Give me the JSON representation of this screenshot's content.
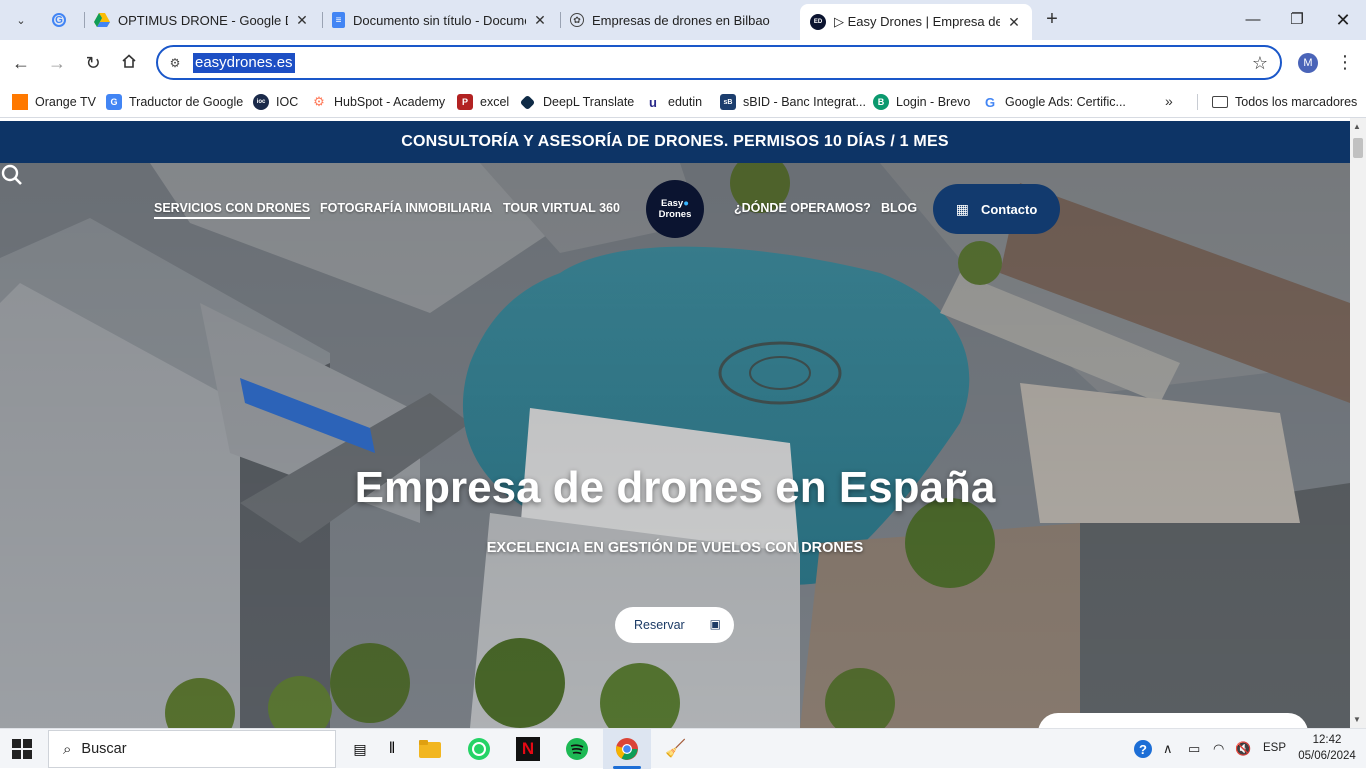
{
  "browser": {
    "tabs": [
      {
        "label": "OPTIMUS DRONE - Google Drive",
        "icon": "google-drive-icon",
        "active": false
      },
      {
        "label": "Documento sin título - Documentos de Google",
        "icon": "google-docs-icon",
        "active": false
      },
      {
        "label": "Empresas de drones en Bilbao",
        "icon": "chatgpt-icon",
        "active": false
      },
      {
        "label": "▷ Easy Drones | Empresa de Servicios con Drones",
        "icon": "easydrones-favicon",
        "active": true
      }
    ],
    "url": "easydrones.es",
    "profile_initial": "M",
    "bookmarks": [
      {
        "label": "Orange TV",
        "icon": "orange-icon",
        "color": "#ff7900"
      },
      {
        "label": "Traductor de Google",
        "icon": "google-translate-icon",
        "color": "#4285f4"
      },
      {
        "label": "IOC",
        "icon": "ioc-icon",
        "color": "#1b2a4a"
      },
      {
        "label": "HubSpot - Academy",
        "icon": "hubspot-icon",
        "color": "#ff7a59"
      },
      {
        "label": "excel",
        "icon": "excel-icon",
        "color": "#b22222"
      },
      {
        "label": "DeepL Translate",
        "icon": "deepl-icon",
        "color": "#0f2b46"
      },
      {
        "label": "edutin",
        "icon": "edutin-icon",
        "color": "#2a2a8a"
      },
      {
        "label": "sBID - Banc Integrat...",
        "icon": "sbid-icon",
        "color": "#1c3e6e"
      },
      {
        "label": "Login - Brevo",
        "icon": "brevo-icon",
        "color": "#0b996e"
      },
      {
        "label": "Google Ads: Certific...",
        "icon": "google-icon",
        "color": "#4285f4"
      }
    ],
    "all_bookmarks_label": "Todos los marcadores"
  },
  "site": {
    "banner": "CONSULTORÍA Y ASESORÍA DE DRONES. PERMISOS 10 DÍAS / 1 MES",
    "nav": {
      "services": "SERVICIOS CON DRONES",
      "real_estate": "FOTOGRAFÍA INMOBILIARIA",
      "tour": "TOUR VIRTUAL 360",
      "where": "¿DÓNDE OPERAMOS?",
      "blog": "BLOG",
      "contact": "Contacto",
      "logo_line1": "Easy",
      "logo_line2": "Drones"
    },
    "hero": {
      "title": "Empresa de drones en España",
      "subtitle": "EXCELENCIA EN GESTIÓN DE VUELOS CON DRONES",
      "cta": "Reservar"
    },
    "colors": {
      "brand": "#0d3466",
      "contact_bg": "#123a6e"
    }
  },
  "taskbar": {
    "search_placeholder": "Buscar",
    "apps": [
      "task-view-icon",
      "file-explorer-icon",
      "whatsapp-icon",
      "netflix-icon",
      "spotify-icon",
      "chrome-icon",
      "cleaner-icon"
    ],
    "language": "ESP",
    "time": "12:42",
    "date": "05/06/2024"
  }
}
